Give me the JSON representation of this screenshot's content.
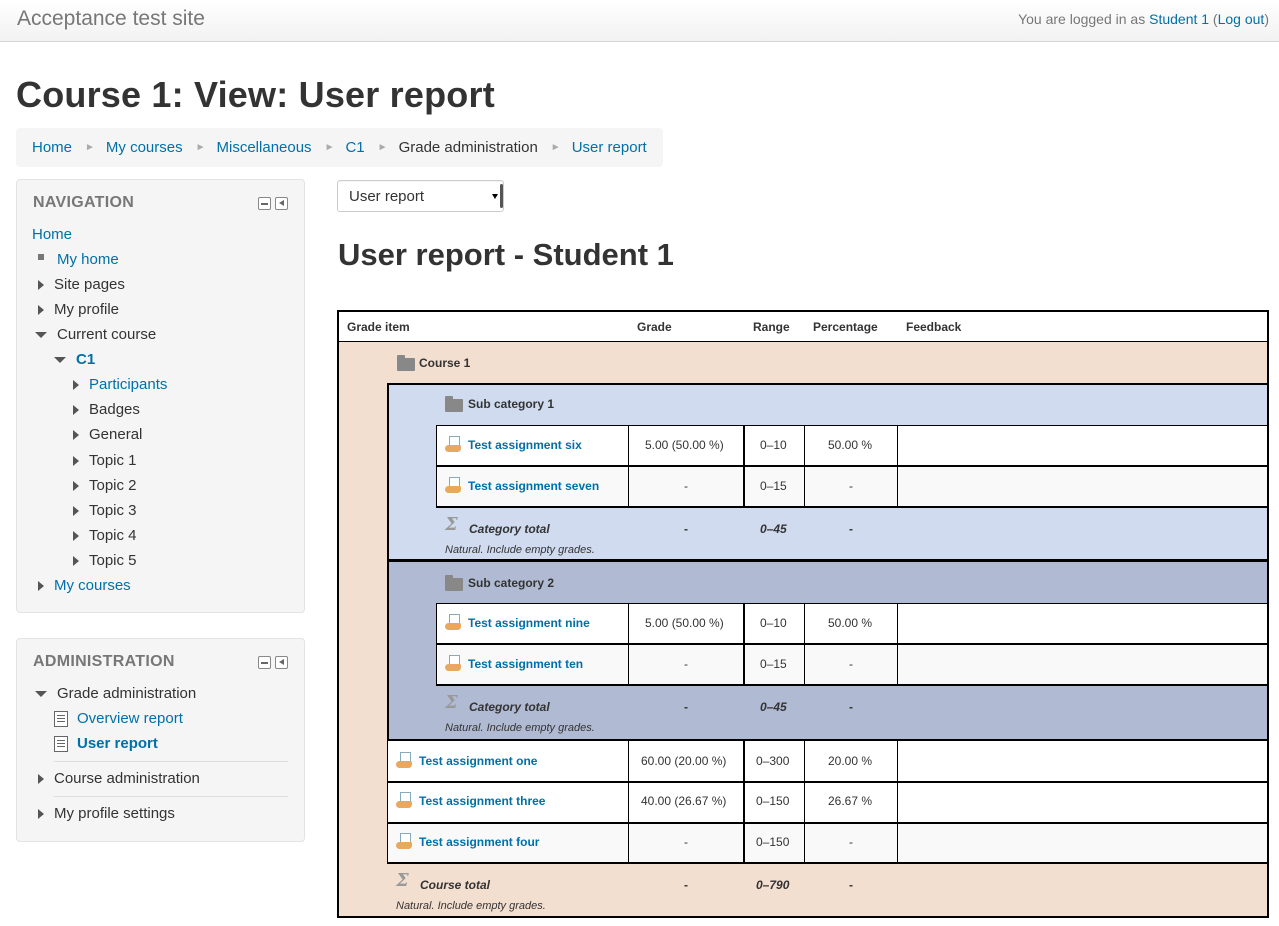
{
  "site": {
    "name": "Acceptance test site",
    "logged_prefix": "You are logged in as ",
    "user": "Student 1",
    "logout": "Log out"
  },
  "page": {
    "title": "Course 1: View: User report",
    "report_heading": "User report - Student 1"
  },
  "breadcrumb": [
    "Home",
    "My courses",
    "Miscellaneous",
    "C1",
    "Grade administration",
    "User report"
  ],
  "navigation": {
    "title": "NAVIGATION",
    "home": "Home",
    "items": {
      "my_home": "My home",
      "site_pages": "Site pages",
      "my_profile": "My profile",
      "current_course": "Current course",
      "c1": "C1",
      "participants": "Participants",
      "badges": "Badges",
      "general": "General",
      "topic1": "Topic 1",
      "topic2": "Topic 2",
      "topic3": "Topic 3",
      "topic4": "Topic 4",
      "topic5": "Topic 5",
      "my_courses": "My courses"
    }
  },
  "administration": {
    "title": "ADMINISTRATION",
    "grade_admin": "Grade administration",
    "overview_report": "Overview report",
    "user_report": "User report",
    "course_admin": "Course administration",
    "profile_settings": "My profile settings"
  },
  "report_select": {
    "selected": "User report"
  },
  "table": {
    "headers": {
      "item": "Grade item",
      "grade": "Grade",
      "range": "Range",
      "percentage": "Percentage",
      "feedback": "Feedback"
    },
    "course": "Course 1",
    "sub1": {
      "name": "Sub category 1",
      "items": [
        {
          "name": "Test assignment six",
          "grade": "5.00 (50.00 %)",
          "range": "0–10",
          "pct": "50.00 %"
        },
        {
          "name": "Test assignment seven",
          "grade": "-",
          "range": "0–15",
          "pct": "-"
        }
      ],
      "total": {
        "label": "Category total",
        "grade": "-",
        "range": "0–45",
        "pct": "-",
        "note": "Natural. Include empty grades."
      }
    },
    "sub2": {
      "name": "Sub category 2",
      "items": [
        {
          "name": "Test assignment nine",
          "grade": "5.00 (50.00 %)",
          "range": "0–10",
          "pct": "50.00 %"
        },
        {
          "name": "Test assignment ten",
          "grade": "-",
          "range": "0–15",
          "pct": "-"
        }
      ],
      "total": {
        "label": "Category total",
        "grade": "-",
        "range": "0–45",
        "pct": "-",
        "note": "Natural. Include empty grades."
      }
    },
    "items": [
      {
        "name": "Test assignment one",
        "grade": "60.00 (20.00 %)",
        "range": "0–300",
        "pct": "20.00 %"
      },
      {
        "name": "Test assignment three",
        "grade": "40.00 (26.67 %)",
        "range": "0–150",
        "pct": "26.67 %"
      },
      {
        "name": "Test assignment four",
        "grade": "-",
        "range": "0–150",
        "pct": "-"
      }
    ],
    "course_total": {
      "label": "Course total",
      "grade": "-",
      "range": "0–790",
      "pct": "-",
      "note": "Natural. Include empty grades."
    }
  }
}
